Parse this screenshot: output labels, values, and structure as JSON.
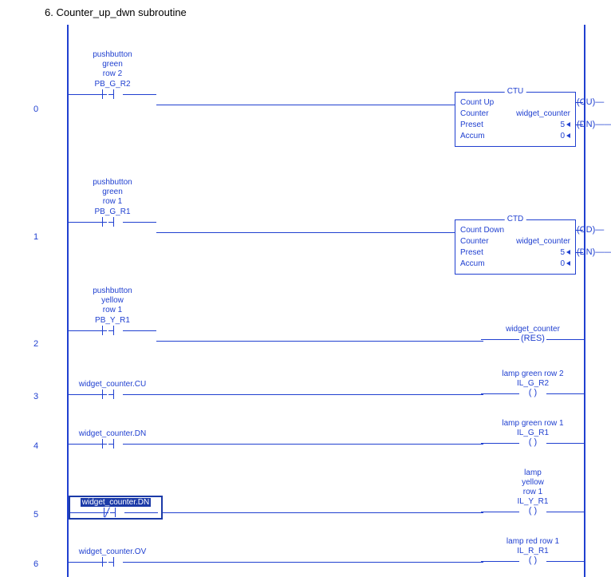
{
  "title": "6.   Counter_up_dwn subroutine",
  "rungs": [
    {
      "num": "0",
      "contact": {
        "desc": "pushbutton\ngreen\nrow 2",
        "tag": "PB_G_R2",
        "type": "XIC"
      },
      "instruction": {
        "header": "CTU",
        "name": "Count Up",
        "counter_label": "Counter",
        "counter_val": "widget_counter",
        "preset_label": "Preset",
        "preset_val": "5",
        "accum_label": "Accum",
        "accum_val": "0",
        "out1": "CU",
        "out2": "DN"
      }
    },
    {
      "num": "1",
      "contact": {
        "desc": "pushbutton\ngreen\nrow 1",
        "tag": "PB_G_R1",
        "type": "XIC"
      },
      "instruction": {
        "header": "CTD",
        "name": "Count Down",
        "counter_label": "Counter",
        "counter_val": "widget_counter",
        "preset_label": "Preset",
        "preset_val": "5",
        "accum_label": "Accum",
        "accum_val": "0",
        "out1": "CD",
        "out2": "DN"
      }
    },
    {
      "num": "2",
      "contact": {
        "desc": "pushbutton\nyellow\nrow 1",
        "tag": "PB_Y_R1",
        "type": "XIC"
      },
      "coil": {
        "label": "widget_counter",
        "type": "RES",
        "sym": "(RES)"
      }
    },
    {
      "num": "3",
      "contact": {
        "tag": "widget_counter.CU",
        "type": "XIC"
      },
      "coil": {
        "label": "lamp green row 2",
        "tag": "IL_G_R2",
        "type": "OTE",
        "sym": "( )"
      }
    },
    {
      "num": "4",
      "contact": {
        "tag": "widget_counter.DN",
        "type": "XIC"
      },
      "coil": {
        "label": "lamp green row 1",
        "tag": "IL_G_R1",
        "type": "OTE",
        "sym": "( )"
      }
    },
    {
      "num": "5",
      "contact": {
        "tag": "widget_counter.DN",
        "type": "XIO",
        "selected": true
      },
      "coil": {
        "label": "lamp\nyellow\nrow 1",
        "tag": "IL_Y_R1",
        "type": "OTE",
        "sym": "( )"
      }
    },
    {
      "num": "6",
      "contact": {
        "tag": "widget_counter.OV",
        "type": "XIC"
      },
      "coil": {
        "label": "lamp red row 1",
        "tag": "IL_R_R1",
        "type": "OTE",
        "sym": "( )"
      }
    }
  ]
}
